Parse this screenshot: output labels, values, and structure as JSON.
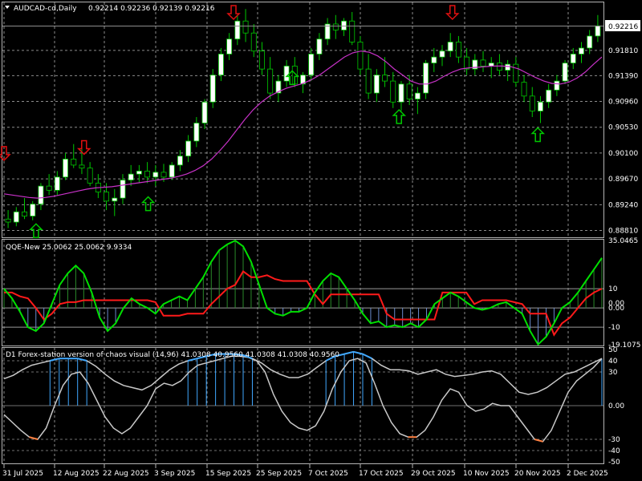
{
  "main": {
    "symbol_label": "AUDCAD-cd,Daily",
    "ohlc_text": "0.92214 0.92236 0.92139 0.92216",
    "current_price": "0.92216",
    "price_ticks": [
      "0.91810",
      "0.91390",
      "0.90960",
      "0.90530",
      "0.90100",
      "0.89670",
      "0.89240",
      "0.88810"
    ],
    "ylim": [
      0.8875,
      0.9245
    ]
  },
  "qqe": {
    "title": "QQE-New 25.0062 25.0062 9.9334",
    "ticks": [
      "35.0465",
      "10",
      "0.00",
      "0.00",
      "-10",
      "-19.1075"
    ],
    "ylim": [
      -19.1075,
      35.0465
    ]
  },
  "chaos": {
    "title": "D1 Forex-station version of chaos visual (14,96) 41.0308 40.9560 41.0308 41.0308 40.9560",
    "ticks": [
      "50",
      "40",
      "30",
      "0.00",
      "-30",
      "-40",
      "-50"
    ],
    "ylim": [
      -50,
      50
    ]
  },
  "dates": [
    "31 Jul 2025",
    "12 Aug 2025",
    "22 Aug 2025",
    "3 Sep 2025",
    "15 Sep 2025",
    "25 Sep 2025",
    "7 Oct 2025",
    "17 Oct 2025",
    "29 Oct 2025",
    "10 Nov 2025",
    "20 Nov 2025",
    "2 Dec 2025"
  ],
  "colors": {
    "bull": "#ffffff",
    "bear": "#000000",
    "wick": "#00c800",
    "ma": "#c832c8",
    "arrow_up": "#00c800",
    "arrow_down": "#e01010",
    "qqe_fast": "#00e000",
    "qqe_slow": "#ff1a1a",
    "chaos_line": "#c8c8c8",
    "chaos_hi": "#40a8ff",
    "chaos_lo": "#ff8040",
    "grid": "#8c8c8c"
  },
  "chart_data": [
    {
      "type": "candlestick",
      "title": "AUDCAD-cd,Daily",
      "ylim": [
        0.8875,
        0.9245
      ],
      "ohlc": [
        [
          0.89,
          0.8915,
          0.8885,
          0.8895
        ],
        [
          0.8895,
          0.892,
          0.8888,
          0.8912
        ],
        [
          0.8912,
          0.8935,
          0.89,
          0.8905
        ],
        [
          0.8905,
          0.893,
          0.8898,
          0.8925
        ],
        [
          0.8925,
          0.896,
          0.8915,
          0.8955
        ],
        [
          0.8955,
          0.8975,
          0.894,
          0.8948
        ],
        [
          0.8948,
          0.898,
          0.894,
          0.897
        ],
        [
          0.897,
          0.901,
          0.8965,
          0.9
        ],
        [
          0.9,
          0.9025,
          0.8985,
          0.899
        ],
        [
          0.899,
          0.902,
          0.8975,
          0.8985
        ],
        [
          0.8985,
          0.8995,
          0.8955,
          0.896
        ],
        [
          0.896,
          0.8975,
          0.8935,
          0.8945
        ],
        [
          0.8945,
          0.896,
          0.8915,
          0.893
        ],
        [
          0.893,
          0.895,
          0.8905,
          0.8935
        ],
        [
          0.8935,
          0.8975,
          0.8925,
          0.8965
        ],
        [
          0.8965,
          0.899,
          0.8955,
          0.8975
        ],
        [
          0.8975,
          0.899,
          0.896,
          0.898
        ],
        [
          0.898,
          0.8995,
          0.896,
          0.897
        ],
        [
          0.897,
          0.899,
          0.8955,
          0.8978
        ],
        [
          0.8978,
          0.8992,
          0.8962,
          0.897
        ],
        [
          0.897,
          0.8995,
          0.8965,
          0.899
        ],
        [
          0.899,
          0.9015,
          0.898,
          0.9005
        ],
        [
          0.9005,
          0.904,
          0.8995,
          0.903
        ],
        [
          0.903,
          0.907,
          0.902,
          0.906
        ],
        [
          0.906,
          0.91,
          0.905,
          0.9095
        ],
        [
          0.9095,
          0.915,
          0.9085,
          0.914
        ],
        [
          0.914,
          0.9185,
          0.913,
          0.9175
        ],
        [
          0.9175,
          0.921,
          0.9165,
          0.92
        ],
        [
          0.92,
          0.924,
          0.919,
          0.923
        ],
        [
          0.923,
          0.925,
          0.9195,
          0.921
        ],
        [
          0.921,
          0.9225,
          0.917,
          0.918
        ],
        [
          0.918,
          0.9195,
          0.914,
          0.915
        ],
        [
          0.915,
          0.917,
          0.91,
          0.911
        ],
        [
          0.911,
          0.914,
          0.9095,
          0.913
        ],
        [
          0.913,
          0.9165,
          0.912,
          0.9155
        ],
        [
          0.9155,
          0.917,
          0.912,
          0.9125
        ],
        [
          0.9125,
          0.9145,
          0.911,
          0.914
        ],
        [
          0.914,
          0.9185,
          0.913,
          0.9175
        ],
        [
          0.9175,
          0.921,
          0.9165,
          0.92
        ],
        [
          0.92,
          0.9235,
          0.919,
          0.9225
        ],
        [
          0.9225,
          0.924,
          0.92,
          0.9215
        ],
        [
          0.9215,
          0.9235,
          0.9205,
          0.923
        ],
        [
          0.923,
          0.9245,
          0.919,
          0.9195
        ],
        [
          0.9195,
          0.9205,
          0.914,
          0.915
        ],
        [
          0.915,
          0.9175,
          0.91,
          0.911
        ],
        [
          0.911,
          0.915,
          0.9095,
          0.914
        ],
        [
          0.914,
          0.917,
          0.912,
          0.913
        ],
        [
          0.913,
          0.9145,
          0.9085,
          0.9095
        ],
        [
          0.9095,
          0.913,
          0.908,
          0.9125
        ],
        [
          0.9125,
          0.914,
          0.909,
          0.91
        ],
        [
          0.91,
          0.912,
          0.9075,
          0.911
        ],
        [
          0.911,
          0.9165,
          0.91,
          0.916
        ],
        [
          0.916,
          0.9185,
          0.9145,
          0.917
        ],
        [
          0.917,
          0.919,
          0.9155,
          0.918
        ],
        [
          0.918,
          0.921,
          0.917,
          0.9195
        ],
        [
          0.9195,
          0.9205,
          0.916,
          0.917
        ],
        [
          0.917,
          0.9185,
          0.914,
          0.915
        ],
        [
          0.915,
          0.9175,
          0.914,
          0.9165
        ],
        [
          0.9165,
          0.918,
          0.9145,
          0.9155
        ],
        [
          0.9155,
          0.917,
          0.9135,
          0.916
        ],
        [
          0.916,
          0.9175,
          0.914,
          0.9148
        ],
        [
          0.9148,
          0.9165,
          0.913,
          0.9158
        ],
        [
          0.9158,
          0.917,
          0.912,
          0.9128
        ],
        [
          0.9128,
          0.914,
          0.9095,
          0.9105
        ],
        [
          0.9105,
          0.912,
          0.907,
          0.908
        ],
        [
          0.908,
          0.9105,
          0.906,
          0.9095
        ],
        [
          0.9095,
          0.9125,
          0.9085,
          0.9115
        ],
        [
          0.9115,
          0.914,
          0.9105,
          0.913
        ],
        [
          0.913,
          0.9165,
          0.9125,
          0.916
        ],
        [
          0.916,
          0.9185,
          0.915,
          0.9175
        ],
        [
          0.9175,
          0.9195,
          0.916,
          0.9185
        ],
        [
          0.9185,
          0.9215,
          0.9175,
          0.9205
        ],
        [
          0.9205,
          0.924,
          0.9195,
          0.9222
        ]
      ],
      "ma": [
        0.8942,
        0.894,
        0.8938,
        0.8936,
        0.8935,
        0.8936,
        0.8938,
        0.8941,
        0.8944,
        0.8947,
        0.895,
        0.8952,
        0.8953,
        0.8954,
        0.8956,
        0.8958,
        0.896,
        0.8962,
        0.8964,
        0.8966,
        0.8968,
        0.8971,
        0.8975,
        0.8981,
        0.8989,
        0.9,
        0.9014,
        0.903,
        0.9048,
        0.9066,
        0.9082,
        0.9095,
        0.9105,
        0.9112,
        0.9118,
        0.9122,
        0.9126,
        0.9132,
        0.914,
        0.915,
        0.916,
        0.917,
        0.9177,
        0.918,
        0.9178,
        0.9172,
        0.9162,
        0.915,
        0.914,
        0.913,
        0.9125,
        0.9125,
        0.913,
        0.9138,
        0.9145,
        0.915,
        0.9152,
        0.9153,
        0.9154,
        0.9155,
        0.9155,
        0.9154,
        0.915,
        0.9143,
        0.9136,
        0.913,
        0.9126,
        0.9125,
        0.9128,
        0.9135,
        0.9145,
        0.9158,
        0.917
      ],
      "arrows": [
        {
          "bar": 0,
          "dir": "down",
          "price": 0.901
        },
        {
          "bar": 6,
          "dir": "up",
          "price": 0.888
        },
        {
          "bar": 15,
          "dir": "down",
          "price": 0.902
        },
        {
          "bar": 27,
          "dir": "up",
          "price": 0.8925
        },
        {
          "bar": 43,
          "dir": "down",
          "price": 0.9245
        },
        {
          "bar": 54,
          "dir": "up",
          "price": 0.9135
        },
        {
          "bar": 74,
          "dir": "up",
          "price": 0.907
        },
        {
          "bar": 84,
          "dir": "down",
          "price": 0.9245
        },
        {
          "bar": 100,
          "dir": "up",
          "price": 0.904
        }
      ]
    },
    {
      "type": "line",
      "title": "QQE-New 25.0062 25.0062 9.9334",
      "ylim": [
        -19.1075,
        35.0465
      ],
      "series": [
        {
          "values": [
            10,
            5,
            -2,
            -10,
            -12,
            -8,
            2,
            12,
            18,
            22,
            18,
            8,
            -5,
            -12,
            -8,
            0,
            5,
            2,
            0,
            -3,
            2,
            4,
            6,
            4,
            10,
            16,
            24,
            30,
            33,
            35,
            32,
            24,
            12,
            0,
            -3,
            -4,
            -2,
            -2,
            0,
            8,
            14,
            18,
            16,
            10,
            4,
            -3,
            -8,
            -7,
            -10,
            -9,
            -10,
            -8,
            -10,
            -6,
            2,
            5,
            8,
            6,
            3,
            0,
            -1,
            0,
            2,
            3,
            0,
            -3,
            -12,
            -19,
            -15,
            -8,
            0,
            3,
            8,
            14,
            20,
            26
          ]
        },
        {
          "values": [
            8,
            8,
            6,
            5,
            0,
            -6,
            -3,
            2,
            3,
            3,
            4,
            4,
            4,
            4,
            4,
            4,
            4,
            4,
            4,
            3,
            -4,
            -4,
            -4,
            -3,
            -3,
            -3,
            2,
            6,
            10,
            12,
            19,
            16,
            16,
            17,
            15,
            14,
            14,
            14,
            14,
            7,
            2,
            7,
            7,
            7,
            7,
            7,
            7,
            7,
            -3,
            -6,
            -6,
            -6,
            -6,
            -6,
            -6,
            8,
            8,
            8,
            8,
            2,
            4,
            4,
            4,
            4,
            3,
            2,
            -3,
            -3,
            -3,
            -14,
            -8,
            -5,
            0,
            5,
            8,
            10
          ]
        }
      ]
    },
    {
      "type": "line",
      "title": "D1 Forex-station version of chaos visual (14,96) 41.0308 40.9560 41.0308 41.0308 40.9560",
      "ylim": [
        -50,
        50
      ],
      "series": [
        {
          "values": [
            -8,
            -15,
            -22,
            -28,
            -30,
            -20,
            0,
            18,
            28,
            30,
            20,
            5,
            -10,
            -20,
            -25,
            -20,
            -10,
            0,
            15,
            20,
            18,
            22,
            30,
            36,
            38,
            40,
            42,
            44,
            44,
            43,
            40,
            30,
            10,
            -5,
            -15,
            -20,
            -22,
            -18,
            -5,
            15,
            30,
            40,
            42,
            38,
            20,
            0,
            -15,
            -25,
            -28,
            -28,
            -22,
            -10,
            5,
            15,
            12,
            0,
            -5,
            -3,
            2,
            0,
            0,
            -10,
            -20,
            -30,
            -32,
            -22,
            -5,
            12,
            22,
            28,
            34,
            42
          ]
        },
        {
          "values": [
            24,
            27,
            32,
            36,
            38,
            40,
            42,
            42,
            42,
            40,
            35,
            28,
            22,
            18,
            16,
            14,
            18,
            25,
            32,
            37,
            40,
            42,
            44,
            46,
            46,
            46,
            45,
            42,
            38,
            32,
            28,
            25,
            25,
            28,
            34,
            40,
            44,
            46,
            48,
            46,
            42,
            36,
            32,
            32,
            31,
            28,
            30,
            32,
            28,
            26,
            27,
            28,
            30,
            31,
            28,
            20,
            12,
            10,
            12,
            16,
            22,
            28,
            30,
            34,
            38,
            42
          ]
        }
      ]
    }
  ]
}
